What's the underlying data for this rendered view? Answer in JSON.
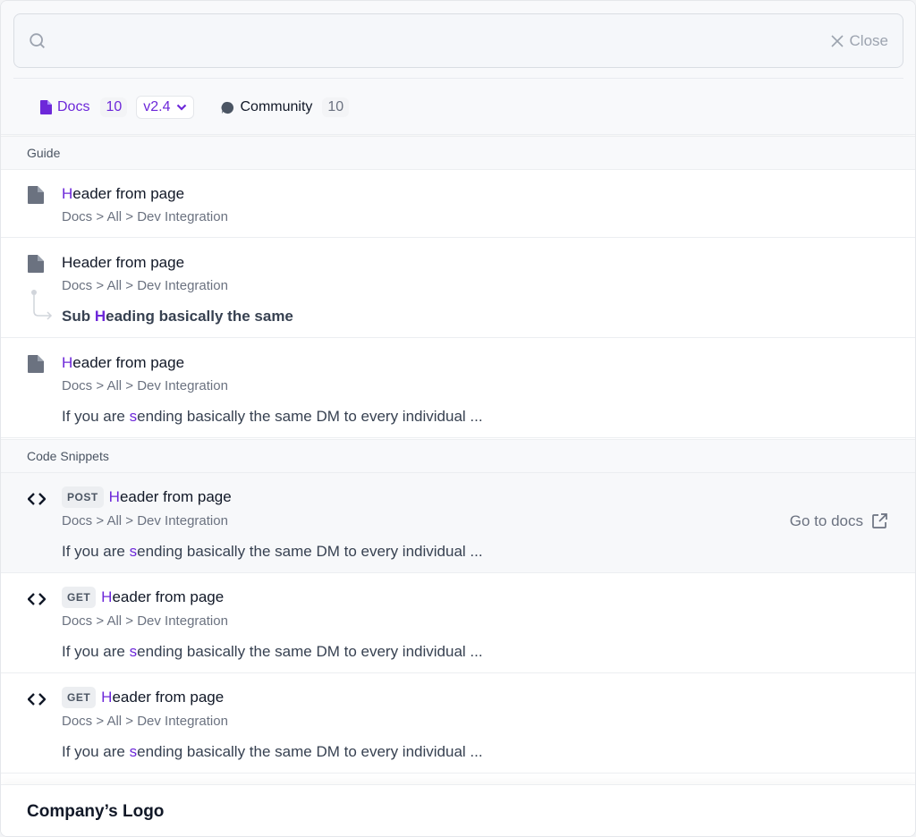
{
  "search": {
    "value": "",
    "placeholder": "",
    "close_label": "Close"
  },
  "filters": {
    "docs_label": "Docs",
    "docs_count": "10",
    "version": "v2.4",
    "community_label": "Community",
    "community_count": "10"
  },
  "sections": {
    "guide": "Guide",
    "code": "Code Snippets"
  },
  "results": [
    {
      "title_hl": "H",
      "title_rest": "eader from page",
      "path": "Docs > All > Dev Integration"
    },
    {
      "title": "Header from page",
      "path": "Docs > All > Dev Integration",
      "sub_pre": "Sub ",
      "sub_hl": "H",
      "sub_rest": "eading basically the same"
    },
    {
      "title_hl": "H",
      "title_rest": "eader from page",
      "path": "Docs > All > Dev Integration",
      "snip_pre": "If you are ",
      "snip_hl": "s",
      "snip_rest": "ending basically the same DM to every individual ..."
    },
    {
      "badge": "POST",
      "title_hl": "H",
      "title_rest": "eader from page",
      "path": "Docs > All > Dev Integration",
      "snip_pre": "If you are ",
      "snip_hl": "s",
      "snip_rest": "ending basically the same DM to every individual ...",
      "action": "Go to docs"
    },
    {
      "badge": "GET",
      "title_hl": "H",
      "title_rest": "eader from page",
      "path": "Docs > All > Dev Integration",
      "snip_pre": "If you are ",
      "snip_hl": "s",
      "snip_rest": "ending basically the same DM to every individual ..."
    },
    {
      "badge": "GET",
      "title_hl": "H",
      "title_rest": "eader from page",
      "path": "Docs > All > Dev Integration",
      "snip_pre": "If you are ",
      "snip_hl": "s",
      "snip_rest": "ending basically the same DM to every individual ..."
    }
  ],
  "footer": {
    "logo": "Company’s Logo"
  },
  "colors": {
    "accent": "#6d28d9",
    "muted": "#6b7280"
  }
}
